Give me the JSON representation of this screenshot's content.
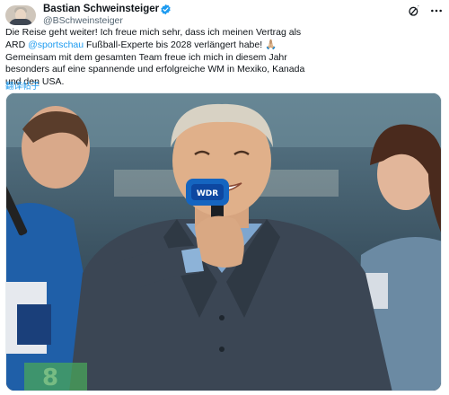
{
  "header": {
    "display_name": "Bastian Schweinsteiger",
    "handle": "@BSchweinsteiger"
  },
  "tweet": {
    "line1": "Die Reise geht weiter! Ich freue mich sehr, dass ich meinen Vertrag als",
    "line2_before": "ARD ",
    "mention": "@sportschau",
    "line2_after": " Fußball-Experte bis 2028 verlängert habe! ",
    "emoji": "🙏🏼",
    "line3": "Gemeinsam mit dem gesamten Team freue ich mich in diesem Jahr",
    "line4": "besonders auf eine spannende und erfolgreiche WM in Mexiko, Kanada",
    "line5": "und den USA.",
    "translate": "翻译帖子"
  },
  "media": {
    "microphone_label": "WDR",
    "shirt_number": "8"
  },
  "icons": {
    "avatar": "avatar-photo",
    "verified": "verified-badge-icon",
    "grok": "grok-icon",
    "more": "more-options-icon"
  },
  "colors": {
    "accent": "#1d9bf0",
    "text": "#0f1419",
    "secondary_text": "#536471"
  }
}
